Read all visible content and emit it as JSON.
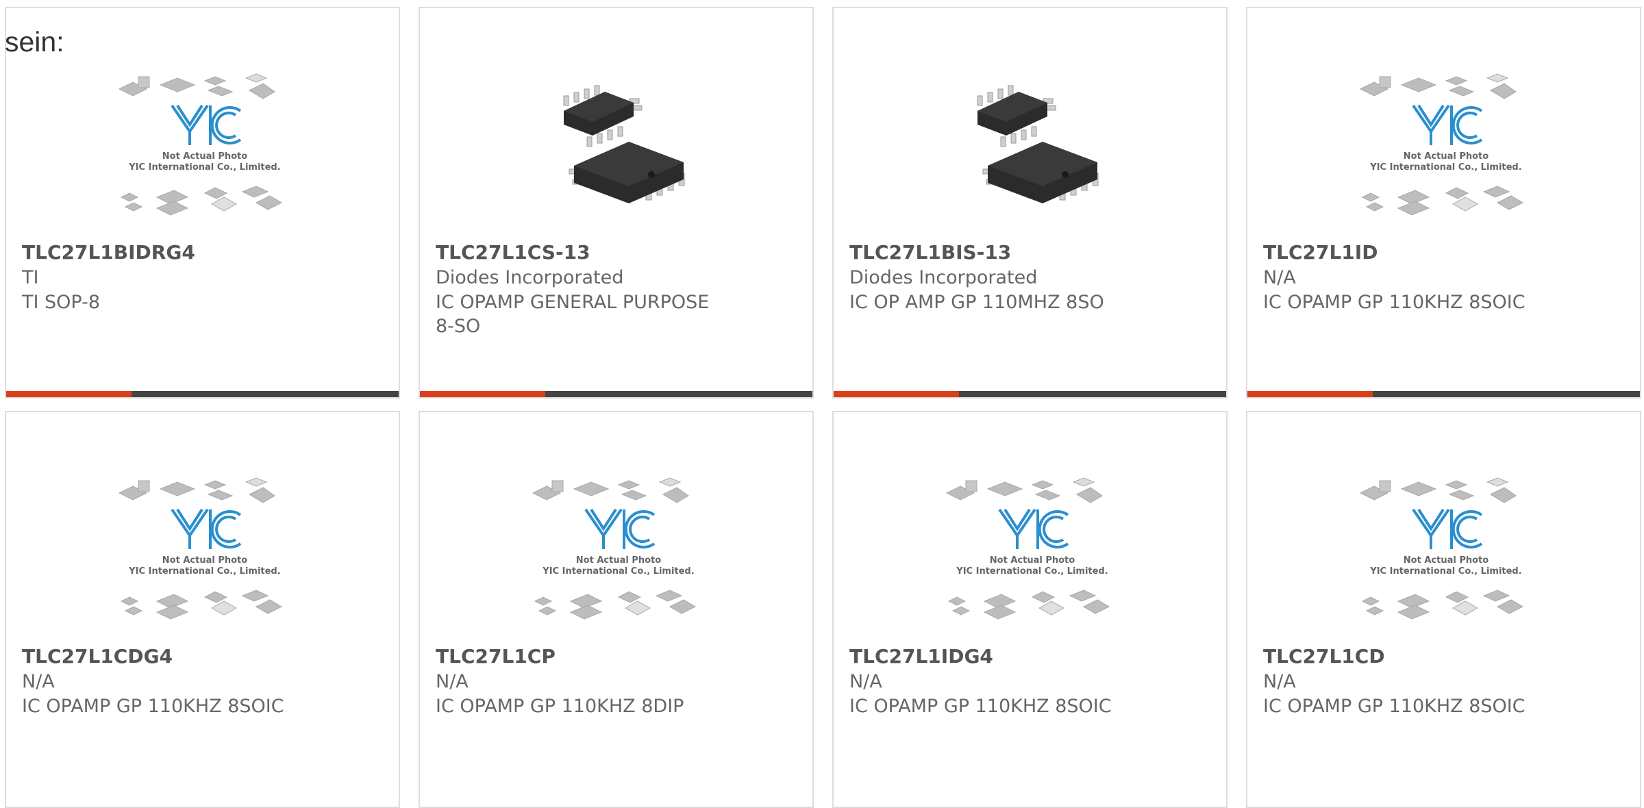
{
  "prefix_text": "sein:",
  "colors": {
    "accent": "#d9401a",
    "bar": "#444444",
    "logo": "#2a8fce"
  },
  "placeholder": {
    "line1": "Not Actual Photo",
    "line2": "YIC International Co., Limited.",
    "logo_text": "YIC"
  },
  "products": [
    {
      "part": "TLC27L1BIDRG4",
      "manufacturer": "TI",
      "description": "TI SOP-8",
      "image": "placeholder"
    },
    {
      "part": "TLC27L1CS-13",
      "manufacturer": "Diodes Incorporated",
      "description": "IC OPAMP GENERAL PURPOSE 8-SO",
      "image": "soic-chip"
    },
    {
      "part": "TLC27L1BIS-13",
      "manufacturer": "Diodes Incorporated",
      "description": "IC OP AMP GP 110MHZ 8SO",
      "image": "soic-chip"
    },
    {
      "part": "TLC27L1ID",
      "manufacturer": "N/A",
      "description": "IC OPAMP GP 110KHZ 8SOIC",
      "image": "placeholder"
    },
    {
      "part": "TLC27L1CDG4",
      "manufacturer": "N/A",
      "description": "IC OPAMP GP 110KHZ 8SOIC",
      "image": "placeholder"
    },
    {
      "part": "TLC27L1CP",
      "manufacturer": "N/A",
      "description": "IC OPAMP GP 110KHZ 8DIP",
      "image": "placeholder"
    },
    {
      "part": "TLC27L1IDG4",
      "manufacturer": "N/A",
      "description": "IC OPAMP GP 110KHZ 8SOIC",
      "image": "placeholder"
    },
    {
      "part": "TLC27L1CD",
      "manufacturer": "N/A",
      "description": "IC OPAMP GP 110KHZ 8SOIC",
      "image": "placeholder"
    }
  ]
}
